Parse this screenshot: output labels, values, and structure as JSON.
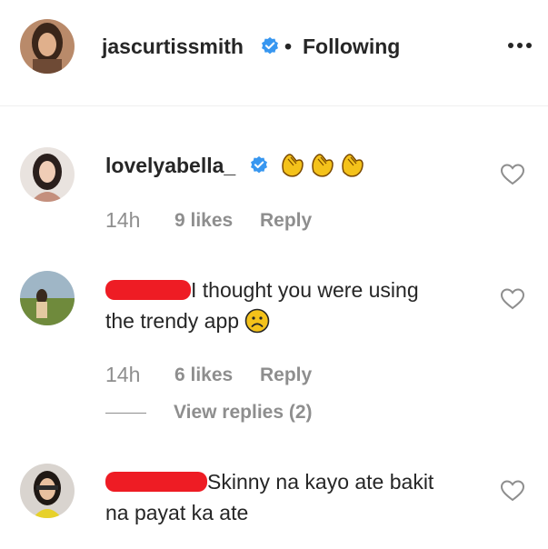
{
  "header": {
    "username": "jascurtissmith",
    "separator": "•",
    "follow_status": "Following",
    "verified": true,
    "icons": [
      "avatar",
      "verified-badge-icon",
      "more-options-icon"
    ]
  },
  "comments": [
    {
      "username": "lovelyabella_",
      "verified": true,
      "text": "",
      "emoji": "clapping-hands x3",
      "time": "14h",
      "likes": "9 likes",
      "reply": "Reply"
    },
    {
      "username_redacted": true,
      "text": "I thought you were using the trendy app",
      "text_line1": "I thought you were using",
      "text_line2": "the trendy app",
      "emoji": "frowning-face",
      "time": "14h",
      "likes": "6 likes",
      "reply": "Reply",
      "view_replies": "View replies (2)"
    },
    {
      "username_redacted": true,
      "text": "Skinny na kayo ate bakit na payat ka ate",
      "text_line1": "Skinny na kayo ate bakit",
      "text_line2": "na payat ka ate"
    }
  ],
  "colors": {
    "text": "#262626",
    "muted": "#8e8e8e",
    "verified_blue": "#3897f0",
    "redaction": "#ee1c24",
    "divider": "#efefef"
  }
}
